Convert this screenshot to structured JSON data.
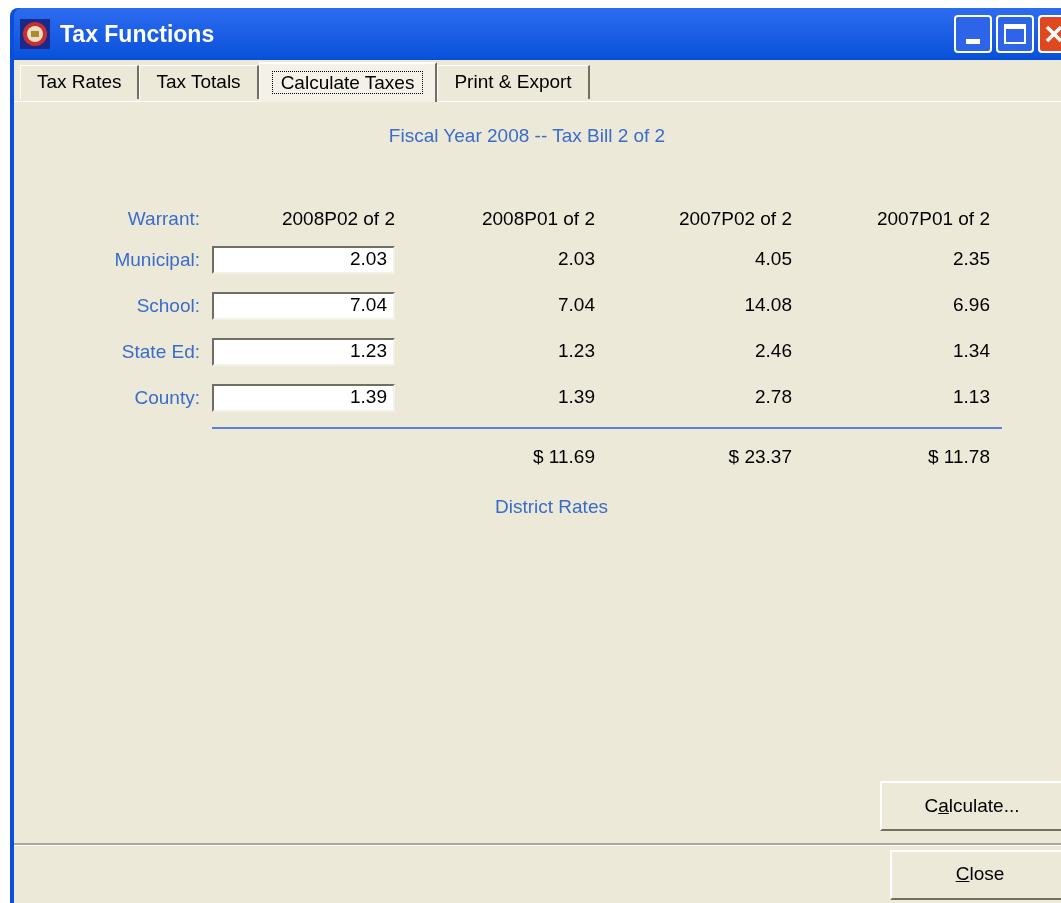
{
  "window": {
    "title": "Tax Functions"
  },
  "tabs": [
    {
      "label": "Tax Rates",
      "selected": false
    },
    {
      "label": "Tax Totals",
      "selected": false
    },
    {
      "label": "Calculate Taxes",
      "selected": true
    },
    {
      "label": "Print & Export",
      "selected": false
    }
  ],
  "heading": "Fiscal Year 2008 -- Tax Bill 2 of 2",
  "warrant": {
    "label": "Warrant:",
    "columns": [
      "2008P02 of 2",
      "2008P01 of 2",
      "2007P02 of 2",
      "2007P01 of 2"
    ]
  },
  "rates": [
    {
      "label": "Municipal:",
      "value": "2.03",
      "values": [
        "2.03",
        "4.05",
        "2.35"
      ]
    },
    {
      "label": "School:",
      "value": "7.04",
      "values": [
        "7.04",
        "14.08",
        "6.96"
      ]
    },
    {
      "label": "State Ed:",
      "value": "1.23",
      "values": [
        "1.23",
        "2.46",
        "1.34"
      ]
    },
    {
      "label": "County:",
      "value": "1.39",
      "values": [
        "1.39",
        "2.78",
        "1.13"
      ]
    }
  ],
  "totals": [
    "$ 11.69",
    "$ 23.37",
    "$ 11.78"
  ],
  "caption": "District Rates",
  "calculate_button": {
    "before": "C",
    "access_key": "a",
    "after": "lculate..."
  },
  "close_button": {
    "access_key": "C",
    "after": "lose"
  }
}
